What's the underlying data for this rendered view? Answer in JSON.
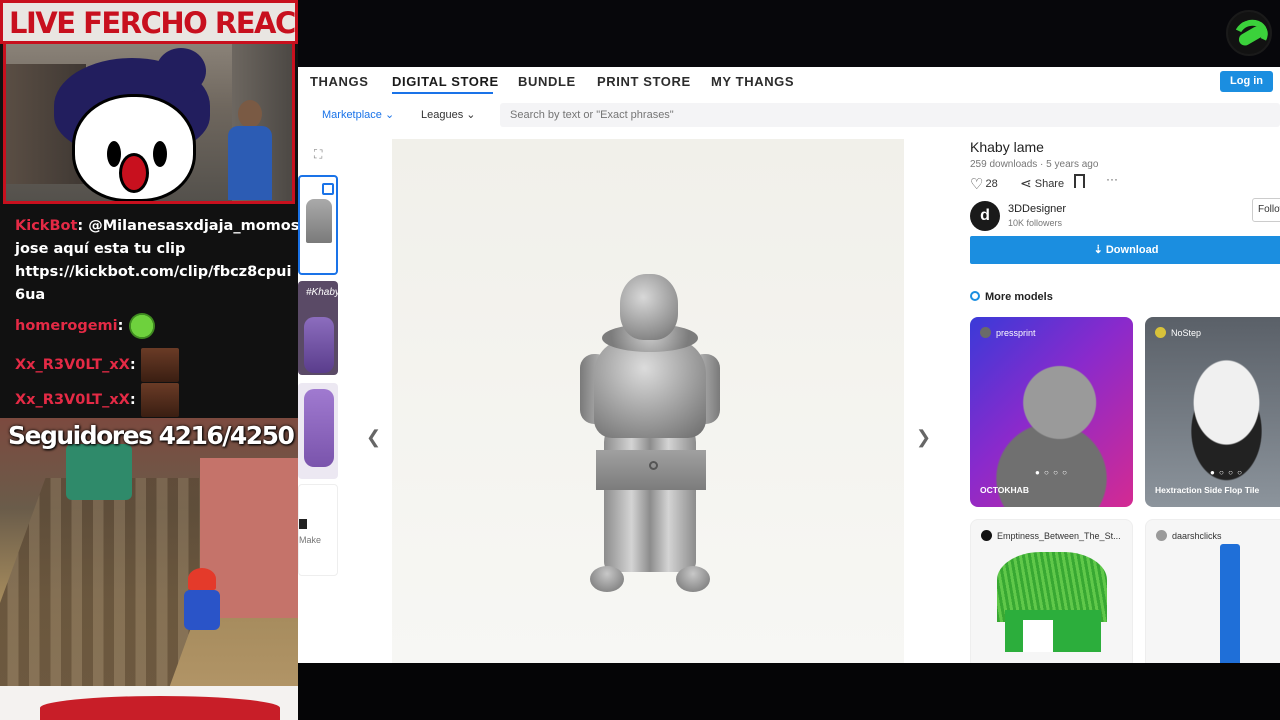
{
  "overlay": {
    "stream_title": "LIVE FERCHO REACTION",
    "chat": [
      {
        "user": "KickBot",
        "text": ": @Milanesasxdjaja_momos"
      },
      {
        "continuation": "jose aquí esta tu clip"
      },
      {
        "continuation": "https://kickbot.com/clip/fbcz8cpui"
      },
      {
        "continuation": "6ua"
      },
      {
        "user": "homerogemi",
        "text": ":"
      },
      {
        "user": "Xx_R3V0LT_xX",
        "text": ":"
      },
      {
        "user": "Xx_R3V0LT_xX",
        "text": ":"
      }
    ],
    "followers_label": "Seguidores 4216/4250"
  },
  "browser": {
    "nav": [
      "THANGS",
      "DIGITAL STORE",
      "BUNDLE",
      "PRINT STORE",
      "MY THANGS"
    ],
    "active_nav": "DIGITAL STORE",
    "login_label": "Log in",
    "subnav": {
      "marketplace": "Marketplace",
      "leagues": "Leagues",
      "search_placeholder": "Search by text or \"Exact phrases\""
    },
    "thumb_make_label": "Make",
    "thumb_khaby_text": "#Khaby",
    "model": {
      "title": "Khaby lame",
      "meta": "259 downloads · 5 years ago",
      "likes": "28",
      "share_label": "Share",
      "more_label": "···",
      "designer": "3DDesigner",
      "followers": "10K followers",
      "follow_label": "Follow",
      "download_label": "Download",
      "more_models_label": "More models"
    },
    "cards": [
      {
        "author": "pressprint",
        "title": "OCTOKHAB",
        "author_color": "#6a6a6a"
      },
      {
        "author": "NoStep",
        "title": "Hextraction Side Flop Tile",
        "author_color": "#d8c23a"
      },
      {
        "author": "Emptiness_Between_The_St...",
        "title": "",
        "author_color": "#111111"
      },
      {
        "author": "daarshclicks",
        "title": "",
        "author_color": "#9a9a9a"
      }
    ],
    "colors": {
      "accent": "#1b8ee0",
      "link": "#1a73e8"
    }
  }
}
